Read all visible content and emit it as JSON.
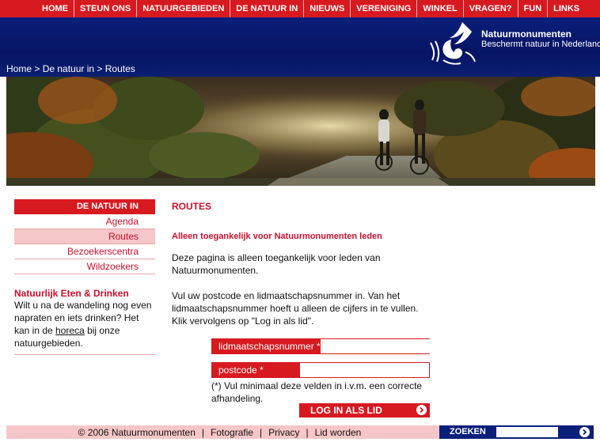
{
  "topnav": {
    "items": [
      {
        "label": "HOME"
      },
      {
        "label": "STEUN ONS"
      },
      {
        "label": "NATUURGEBIEDEN"
      },
      {
        "label": "DE NATUUR IN"
      },
      {
        "label": "NIEUWS"
      },
      {
        "label": "VERENIGING"
      },
      {
        "label": "WINKEL"
      },
      {
        "label": "VRAGEN?"
      },
      {
        "label": "FUN"
      },
      {
        "label": "LINKS"
      }
    ]
  },
  "breadcrumb": {
    "home": "Home",
    "sep": " > ",
    "section": "De natuur in",
    "current": "Routes"
  },
  "logo": {
    "name": "Natuurmonumenten",
    "tagline": "Beschermt natuur in Nederland"
  },
  "leftnav": {
    "heading": "DE NATUUR IN",
    "items": [
      {
        "label": "Agenda"
      },
      {
        "label": "Routes"
      },
      {
        "label": "Bezoekerscentra"
      },
      {
        "label": "Wildzoekers"
      }
    ]
  },
  "promo": {
    "title": "Natuurlijk Eten & Drinken",
    "text_before": "Wilt u na de wandeling nog even napraten en iets drinken? Het kan in de ",
    "link": "horeca",
    "text_after": " bij onze natuurgebieden."
  },
  "main": {
    "title": "ROUTES",
    "subtitle": "Alleen toegankelijk voor Natuurmonumenten leden",
    "para1": "Deze pagina is alleen toegankelijk voor leden van Natuurmonumenten.",
    "para2": "Vul uw postcode en lidmaatschapsnummer in. Van het lidmaatschapsnummer hoeft u alleen de cijfers in te vullen. Klik vervolgens op \"Log in als lid\"."
  },
  "form": {
    "member_label": "lidmaatschapsnummer *",
    "member_value": "",
    "postcode_label": "postcode *",
    "postcode_value": "",
    "note": "(*) Vul minimaal deze velden in i.v.m. een correcte afhandeling.",
    "login_label": "LOG IN ALS LID"
  },
  "footer": {
    "copyright": "© 2006 Natuurmonumenten",
    "sep": "|",
    "links": [
      "Fotografie",
      "Privacy",
      "Lid worden"
    ]
  },
  "search": {
    "label": "ZOEKEN",
    "value": ""
  },
  "colors": {
    "brand_red": "#d71920",
    "brand_blue": "#0b1f7a",
    "pink": "#f6c6c8"
  }
}
